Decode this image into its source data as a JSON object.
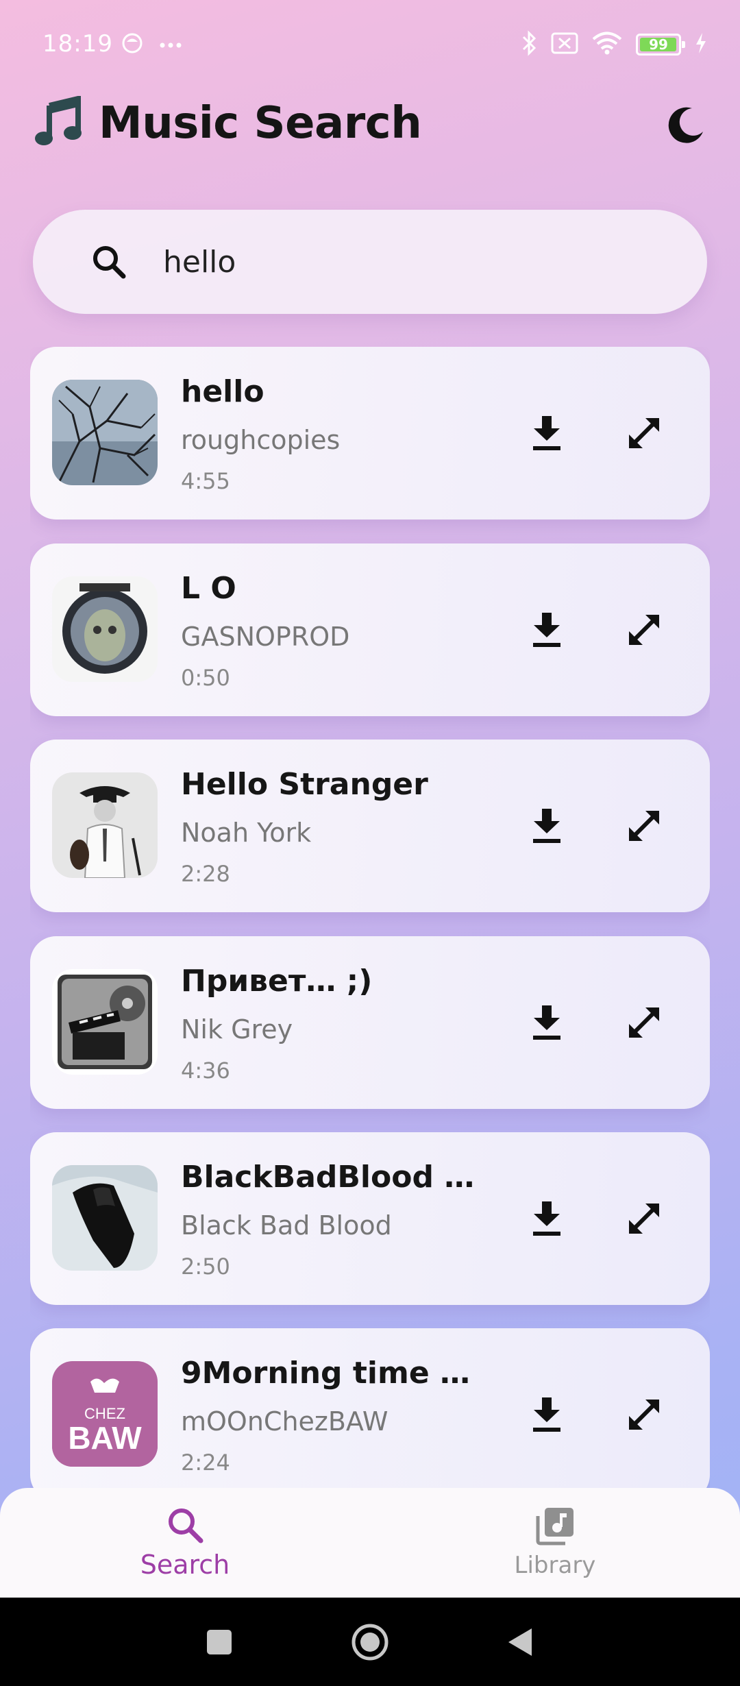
{
  "status_bar": {
    "time": "18:19",
    "battery_level": "99",
    "battery_fraction": 0.99,
    "icons": [
      "face-icon",
      "more-dots-icon",
      "bluetooth-icon",
      "sim-off-icon",
      "wifi-icon",
      "battery-icon",
      "charging-icon"
    ]
  },
  "header": {
    "title": "Music Search",
    "title_icon": "music-note-icon",
    "theme_toggle_icon": "moon-icon"
  },
  "search": {
    "value": "hello",
    "icon": "search-icon"
  },
  "results": [
    {
      "title": "hello",
      "artist": "roughcopies",
      "duration": "4:55",
      "thumb": "bare-tree-branches"
    },
    {
      "title": "L O",
      "artist": "GASNOPROD",
      "duration": "0:50",
      "thumb": "face-in-lens"
    },
    {
      "title": "Hello Stranger",
      "artist": "Noah York",
      "duration": "2:28",
      "thumb": "man-with-violin"
    },
    {
      "title": "Привет… ;)",
      "artist": "Nik Grey",
      "duration": "4:36",
      "thumb": "film-clapper"
    },
    {
      "title": "BlackBadBlood - …",
      "artist": "Black Bad Blood",
      "duration": "2:50",
      "thumb": "black-guitar-case"
    },
    {
      "title": "9Morning time  m…",
      "artist": "mOOnChezBAW",
      "duration": "2:24",
      "thumb": "chez-baw-logo",
      "thumb_text": "CHEZ BAW"
    }
  ],
  "actions": {
    "download_icon": "download-icon",
    "expand_icon": "expand-icon"
  },
  "bottom_nav": {
    "items": [
      {
        "label": "Search",
        "icon": "search-icon",
        "active": true
      },
      {
        "label": "Library",
        "icon": "library-music-icon",
        "active": false
      }
    ]
  },
  "colors": {
    "accent": "#9d3ea6",
    "inactive": "#9a9a9a"
  }
}
